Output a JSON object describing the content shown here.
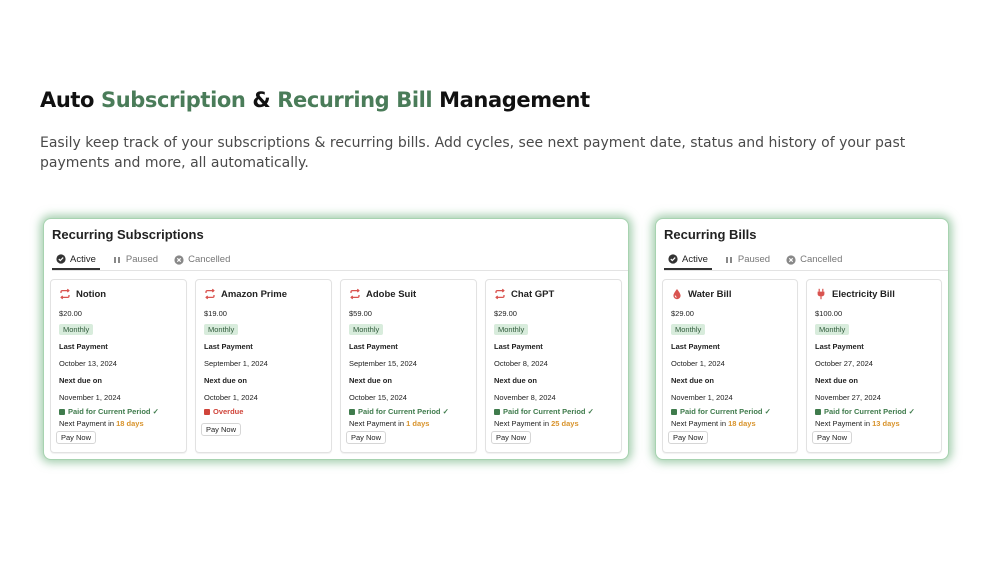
{
  "header": {
    "title_part1": "Auto ",
    "title_accent1": "Subscription",
    "title_amp": " & ",
    "title_accent2": "Recurring Bill",
    "title_part3": " Management",
    "subtitle": "Easily keep track of your subscriptions & recurring bills. Add cycles, see next payment date, status and history of your past payments and more, all automatically."
  },
  "colors": {
    "accent": "#4a7c59",
    "glow": "#5ca870",
    "paid": "#3f7b4c",
    "overdue": "#d0443a",
    "days": "#d8932b",
    "icon_red": "#d9534f"
  },
  "subscriptions": {
    "title": "Recurring Subscriptions",
    "tabs": [
      {
        "label": "Active",
        "icon": "check-circle-icon"
      },
      {
        "label": "Paused",
        "icon": "pause-icon"
      },
      {
        "label": "Cancelled",
        "icon": "x-circle-icon"
      }
    ],
    "cards": [
      {
        "name": "Notion",
        "icon": "repeat-icon",
        "price": "$20.00",
        "cycle": "Monthly",
        "last_label": "Last Payment",
        "last_date": "October 13, 2024",
        "next_label": "Next due on",
        "next_date": "November 1, 2024",
        "status": "Paid for Current Period ✓",
        "next_prefix": "Next Payment in ",
        "next_days": "18 days",
        "pay": "Pay Now"
      },
      {
        "name": "Amazon Prime",
        "icon": "repeat-icon",
        "price": "$19.00",
        "cycle": "Monthly",
        "last_label": "Last Payment",
        "last_date": "September 1, 2024",
        "next_label": "Next due on",
        "next_date": "October 1, 2024",
        "status": "Overdue",
        "pay": "Pay Now"
      },
      {
        "name": "Adobe Suit",
        "icon": "repeat-icon",
        "price": "$59.00",
        "cycle": "Monthly",
        "last_label": "Last Payment",
        "last_date": "September 15, 2024",
        "next_label": "Next due on",
        "next_date": "October 15, 2024",
        "status": "Paid for Current Period ✓",
        "next_prefix": "Next Payment in ",
        "next_days": "1 days",
        "pay": "Pay Now"
      },
      {
        "name": "Chat GPT",
        "icon": "repeat-icon",
        "price": "$29.00",
        "cycle": "Monthly",
        "last_label": "Last Payment",
        "last_date": "October 8, 2024",
        "next_label": "Next due on",
        "next_date": "November 8, 2024",
        "status": "Paid for Current Period ✓",
        "next_prefix": "Next Payment in ",
        "next_days": "25 days",
        "pay": "Pay Now"
      }
    ]
  },
  "bills": {
    "title": "Recurring Bills",
    "tabs": [
      {
        "label": "Active",
        "icon": "check-circle-icon"
      },
      {
        "label": "Paused",
        "icon": "pause-icon"
      },
      {
        "label": "Cancelled",
        "icon": "x-circle-icon"
      }
    ],
    "cards": [
      {
        "name": "Water Bill",
        "icon": "water-drop-icon",
        "price": "$29.00",
        "cycle": "Monthly",
        "last_label": "Last Payment",
        "last_date": "October 1, 2024",
        "next_label": "Next due on",
        "next_date": "November 1, 2024",
        "status": "Paid for Current Period ✓",
        "next_prefix": "Next Payment in ",
        "next_days": "18 days",
        "pay": "Pay Now"
      },
      {
        "name": "Electricity Bill",
        "icon": "plug-icon",
        "price": "$100.00",
        "cycle": "Monthly",
        "last_label": "Last Payment",
        "last_date": "October 27, 2024",
        "next_label": "Next due on",
        "next_date": "November 27, 2024",
        "status": "Paid for Current Period ✓",
        "next_prefix": "Next Payment in ",
        "next_days": "13 days",
        "pay": "Pay Now"
      }
    ]
  }
}
